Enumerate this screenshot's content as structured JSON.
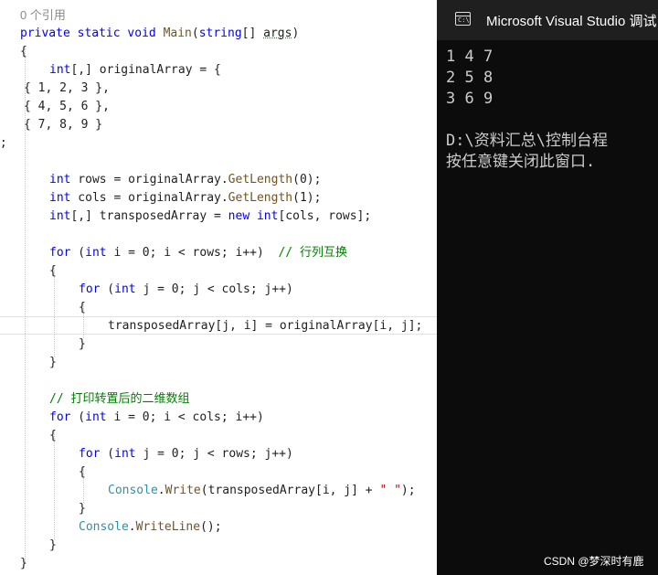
{
  "editor": {
    "ref_count": "0 个引用",
    "lines": {
      "l1": {
        "kw1": "private",
        "kw2": "static",
        "kw3": "void",
        "method": "Main",
        "p1": "(",
        "type": "string",
        "p2": "[] ",
        "param": "args",
        "p3": ")"
      },
      "l2": "{",
      "l3": {
        "type": "int",
        "rest": "[,] originalArray = {"
      },
      "l4": "{ 1, 2, 3 },",
      "l5": "{ 4, 5, 6 },",
      "l6": "{ 7, 8, 9 }",
      "l7": "};",
      "l8": {
        "type": "int",
        "a": " rows = originalArray.",
        "method": "GetLength",
        "b": "(0);"
      },
      "l9": {
        "type": "int",
        "a": " cols = originalArray.",
        "method": "GetLength",
        "b": "(1);"
      },
      "l10": {
        "type": "int",
        "a": "[,] transposedArray = ",
        "kw": "new",
        "type2": "int",
        "b": "[cols, rows];"
      },
      "l11": {
        "kw": "for",
        "a": " (",
        "type": "int",
        "b": " i = 0; i < rows; i++)  ",
        "comment": "// 行列互换"
      },
      "l12": "{",
      "l13": {
        "kw": "for",
        "a": " (",
        "type": "int",
        "b": " j = 0; j < cols; j++)"
      },
      "l14": "{",
      "l15": "transposedArray[j, i] = originalArray[i, j];",
      "l16": "}",
      "l17": "}",
      "l18": "// 打印转置后的二维数组",
      "l19": {
        "kw": "for",
        "a": " (",
        "type": "int",
        "b": " i = 0; i < cols; i++)"
      },
      "l20": "{",
      "l21": {
        "kw": "for",
        "a": " (",
        "type": "int",
        "b": " j = 0; j < rows; j++)"
      },
      "l22": "{",
      "l23": {
        "cls": "Console",
        "dot": ".",
        "method": "Write",
        "a": "(transposedArray[i, j] + ",
        "str": "\" \"",
        "b": ");"
      },
      "l24": "}",
      "l25": {
        "cls": "Console",
        "dot": ".",
        "method": "WriteLine",
        "a": "();"
      },
      "l26": "}",
      "l27": "}"
    }
  },
  "console": {
    "title": "Microsoft Visual Studio 调试",
    "icon": "console-app-icon",
    "icon_glyph": "C:\\",
    "output": [
      "1 4 7",
      "2 5 8",
      "3 6 9"
    ],
    "path_line": "D:\\资料汇总\\控制台程",
    "prompt_line": "按任意键关闭此窗口."
  },
  "watermark": "CSDN @梦深时有鹿"
}
